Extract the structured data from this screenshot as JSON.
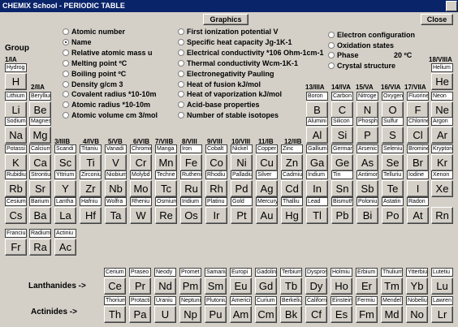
{
  "title": "CHEMIX School - PERIODIC TABLE",
  "buttons": {
    "graphics": "Graphics",
    "close": "Close"
  },
  "group_label": "Group",
  "left_options": [
    "Atomic number",
    "Name",
    "Relative atomic mass  u",
    "Melting point ºC",
    "Boiling point ºC",
    "Density   g/cm 3",
    "Covalent radius   *10-10m",
    "Atomic radius      *10-10m",
    "Atomic volume  cm 3/mol"
  ],
  "mid_options": [
    "First ionization potential V",
    "Specific heat capacity      Jg-1K-1",
    "Electrical conductivity  *106 Ohm-1cm-1",
    "Thermal conductivity     Wcm-1K-1",
    "Electronegativity Pauling",
    "Heat of fusion kJ/mol",
    "Heat of vaporization kJ/mol",
    "Acid-base properties",
    "Number of stable isotopes"
  ],
  "right_options": [
    "Electron configuration",
    "Oxidation states",
    "Phase",
    "Crystal structure"
  ],
  "phase_temp": "20 ºC",
  "groups": [
    "1/IA",
    "2/IIA",
    "3/IIIB",
    "4/IVB",
    "5/VB",
    "6/VIB",
    "7/VIIB",
    "8/VIII",
    "9/VIII",
    "10/VIII",
    "11/IB",
    "12/IIB",
    "13/IIIA",
    "14/IVA",
    "15/VA",
    "16/VIA",
    "17/VIIA",
    "18/VIIIA"
  ],
  "series_labels": {
    "lanthanides": "Lanthanides ->",
    "actinides": "Actinides  ->"
  },
  "elements": [
    [
      "Hydrog",
      "H",
      1,
      1
    ],
    [
      "Helium",
      "He",
      18,
      1
    ],
    [
      "Lithium",
      "Li",
      1,
      2
    ],
    [
      "Beryllium",
      "Be",
      2,
      2
    ],
    [
      "Boron",
      "B",
      13,
      2
    ],
    [
      "Carbon",
      "C",
      14,
      2
    ],
    [
      "Nitroge",
      "N",
      15,
      2
    ],
    [
      "Oxygen",
      "O",
      16,
      2
    ],
    [
      "Fluorine",
      "F",
      17,
      2
    ],
    [
      "Neon",
      "Ne",
      18,
      2
    ],
    [
      "Sodium",
      "Na",
      1,
      3
    ],
    [
      "Magnes",
      "Mg",
      2,
      3
    ],
    [
      "Alumini",
      "Al",
      13,
      3
    ],
    [
      "Silicon",
      "Si",
      14,
      3
    ],
    [
      "Phosph",
      "P",
      15,
      3
    ],
    [
      "Sulfur",
      "S",
      16,
      3
    ],
    [
      "Chlorine",
      "Cl",
      17,
      3
    ],
    [
      "Argon",
      "Ar",
      18,
      3
    ],
    [
      "Potassi",
      "K",
      1,
      4
    ],
    [
      "Calcium",
      "Ca",
      2,
      4
    ],
    [
      "Scandi",
      "Sc",
      3,
      4
    ],
    [
      "Titaniu",
      "Ti",
      4,
      4
    ],
    [
      "Vanadi",
      "V",
      5,
      4
    ],
    [
      "Chromiu",
      "Cr",
      6,
      4
    ],
    [
      "Manga",
      "Mn",
      7,
      4
    ],
    [
      "Iron",
      "Fe",
      8,
      4
    ],
    [
      "Cobalt",
      "Co",
      9,
      4
    ],
    [
      "Nickel",
      "Ni",
      10,
      4
    ],
    [
      "Copper",
      "Cu",
      11,
      4
    ],
    [
      "Zinc",
      "Zn",
      12,
      4
    ],
    [
      "Gallium",
      "Ga",
      13,
      4
    ],
    [
      "Germani",
      "Ge",
      14,
      4
    ],
    [
      "Arsenic",
      "As",
      15,
      4
    ],
    [
      "Seleniu",
      "Se",
      16,
      4
    ],
    [
      "Bromine",
      "Br",
      17,
      4
    ],
    [
      "Krypton",
      "Kr",
      18,
      4
    ],
    [
      "Rubidiu",
      "Rb",
      1,
      5
    ],
    [
      "Strontiu",
      "Sr",
      2,
      5
    ],
    [
      "Yttrium",
      "Y",
      3,
      5
    ],
    [
      "Zirconiu",
      "Zr",
      4,
      5
    ],
    [
      "Niobium",
      "Nb",
      5,
      5
    ],
    [
      "Molybd",
      "Mo",
      6,
      5
    ],
    [
      "Techne",
      "Tc",
      7,
      5
    ],
    [
      "Rutheni",
      "Ru",
      8,
      5
    ],
    [
      "Rhodiu",
      "Rh",
      9,
      5
    ],
    [
      "Palladiu",
      "Pd",
      10,
      5
    ],
    [
      "Silver",
      "Ag",
      11,
      5
    ],
    [
      "Cadmiu",
      "Cd",
      12,
      5
    ],
    [
      "Indium",
      "In",
      13,
      5
    ],
    [
      "Tin",
      "Sn",
      14,
      5
    ],
    [
      "Antimon",
      "Sb",
      15,
      5
    ],
    [
      "Telluriu",
      "Te",
      16,
      5
    ],
    [
      "Iodine",
      "I",
      17,
      5
    ],
    [
      "Xenon",
      "Xe",
      18,
      5
    ],
    [
      "Cesium",
      "Cs",
      1,
      6
    ],
    [
      "Barium",
      "Ba",
      2,
      6
    ],
    [
      "Lantha",
      "La",
      3,
      6
    ],
    [
      "Hafniu",
      "Hf",
      4,
      6
    ],
    [
      "Wolfra",
      "Ta",
      5,
      6
    ],
    [
      "Rheniu",
      "W",
      6,
      6
    ],
    [
      "Osmium",
      "Re",
      7,
      6
    ],
    [
      "Iridium",
      "Os",
      8,
      6
    ],
    [
      "Platinu",
      "Ir",
      9,
      6
    ],
    [
      "Gold",
      "Pt",
      10,
      6
    ],
    [
      "Mercury",
      "Au",
      11,
      6
    ],
    [
      "Thalliu",
      "Hg",
      12,
      6
    ],
    [
      "Lead",
      "Tl",
      13,
      6
    ],
    [
      "Bismuth",
      "Pb",
      14,
      6
    ],
    [
      "Poloniu",
      "Bi",
      15,
      6
    ],
    [
      "Astatin",
      "Po",
      16,
      6
    ],
    [
      "Radon",
      "At",
      17,
      6
    ],
    [
      "",
      "Rn",
      18,
      6
    ],
    [
      "Franciu",
      "Fr",
      1,
      7
    ],
    [
      "Radium",
      "Ra",
      2,
      7
    ],
    [
      "Actiniu",
      "Ac",
      3,
      7
    ]
  ],
  "lanthanides": [
    [
      "Cerium",
      "Ce"
    ],
    [
      "Praseo",
      "Pr"
    ],
    [
      "Neody",
      "Nd"
    ],
    [
      "Promet",
      "Pm"
    ],
    [
      "Samariu",
      "Sm"
    ],
    [
      "Europi",
      "Eu"
    ],
    [
      "Gadolini",
      "Gd"
    ],
    [
      "Terbium",
      "Tb"
    ],
    [
      "Dyspros",
      "Dy"
    ],
    [
      "Holmiu",
      "Ho"
    ],
    [
      "Erbium",
      "Er"
    ],
    [
      "Thulium",
      "Tm"
    ],
    [
      "Ytterbiu",
      "Yb"
    ],
    [
      "Lutetiu",
      "Lu"
    ]
  ],
  "actinides": [
    [
      "Thorium",
      "Th"
    ],
    [
      "Protacti",
      "Pa"
    ],
    [
      "Uraniu",
      "U"
    ],
    [
      "Neptuni",
      "Np"
    ],
    [
      "Plutoniu",
      "Pu"
    ],
    [
      "Americi",
      "Am"
    ],
    [
      "Curium",
      "Cm"
    ],
    [
      "Berkeliu",
      "Bk"
    ],
    [
      "Californ",
      "Cf"
    ],
    [
      "Einstein",
      "Es"
    ],
    [
      "Fermiu",
      "Fm"
    ],
    [
      "Mendel",
      "Md"
    ],
    [
      "Nobeliu",
      "No"
    ],
    [
      "Lawren",
      "Lr"
    ]
  ]
}
